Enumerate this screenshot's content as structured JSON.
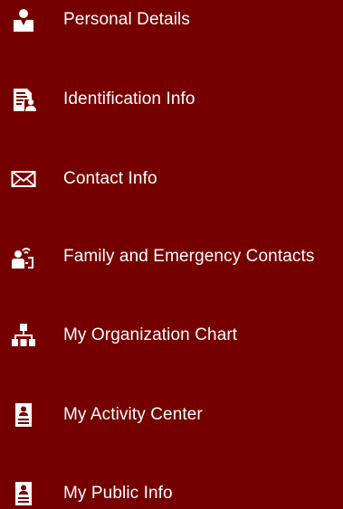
{
  "colors": {
    "background": "#760000",
    "text": "#ffffff"
  },
  "menu": {
    "items": [
      {
        "label": "Personal Details",
        "icon": "person-icon"
      },
      {
        "label": "Identification Info",
        "icon": "id-document-icon"
      },
      {
        "label": "Contact Info",
        "icon": "envelope-icon"
      },
      {
        "label": "Family and Emergency Contacts",
        "icon": "family-contacts-icon"
      },
      {
        "label": "My Organization Chart",
        "icon": "org-chart-icon"
      },
      {
        "label": "My Activity Center",
        "icon": "badge-icon"
      },
      {
        "label": "My Public Info",
        "icon": "badge-icon"
      }
    ]
  }
}
